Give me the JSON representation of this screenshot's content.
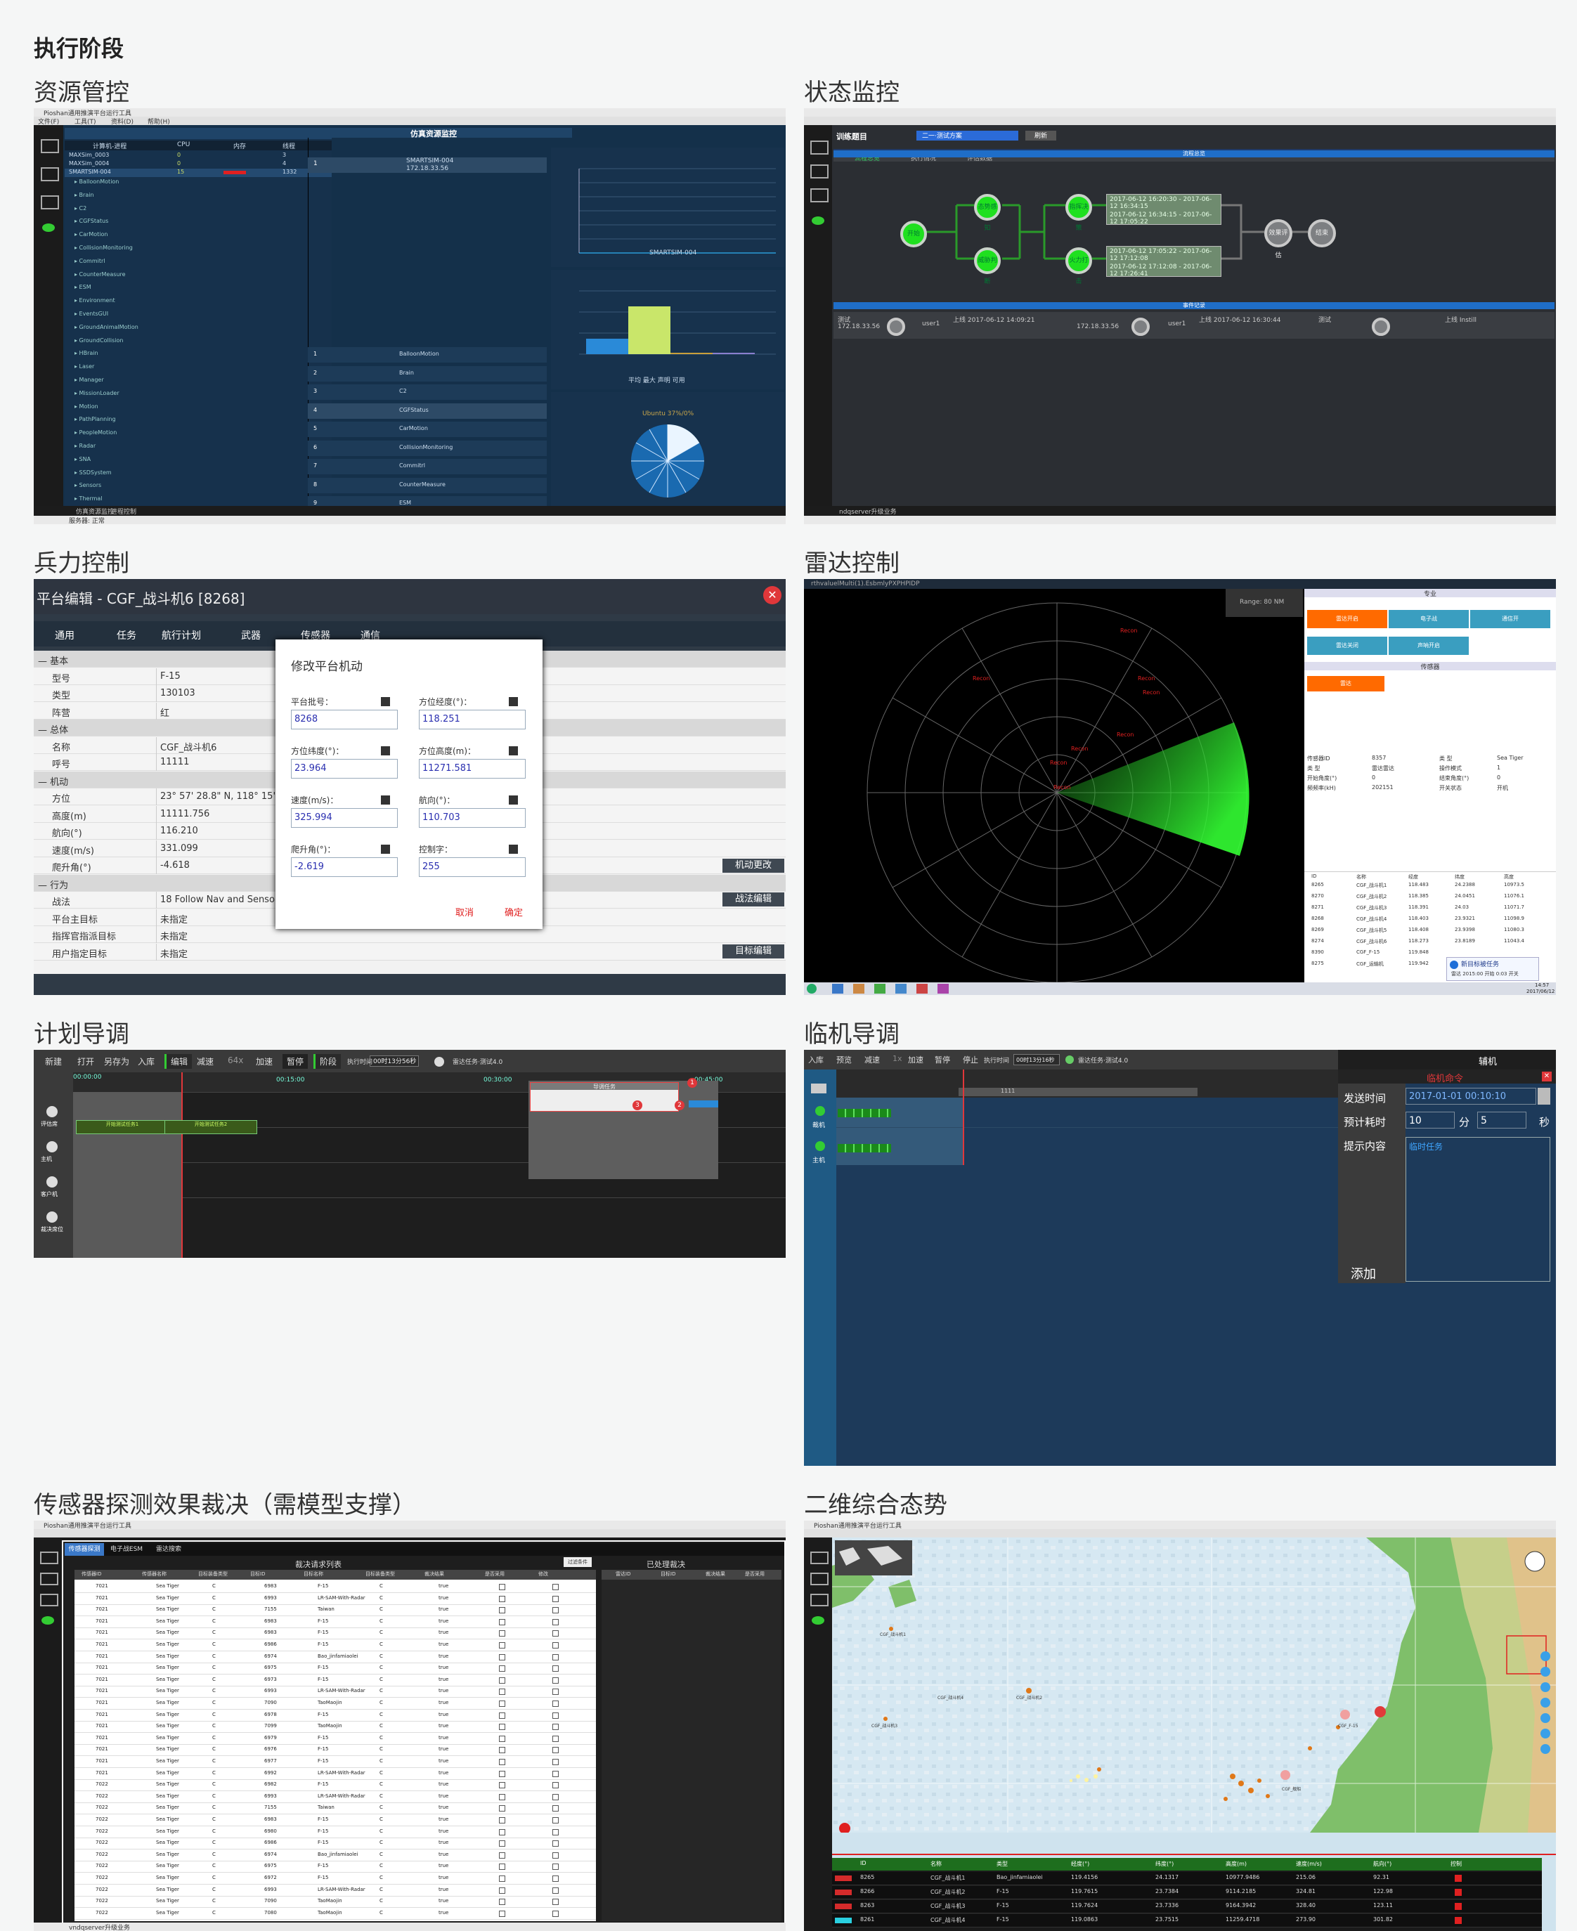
{
  "page": {
    "title": "执行阶段"
  },
  "sections": [
    {
      "label": "资源管控"
    },
    {
      "label": "状态监控"
    },
    {
      "label": "兵力控制"
    },
    {
      "label": "雷达控制"
    },
    {
      "label": "计划导调"
    },
    {
      "label": "临机导调"
    },
    {
      "label": "传感器探测效果裁决（需模型支撑）"
    },
    {
      "label": "二维综合态势"
    }
  ],
  "resource": {
    "window_title": "Pioshan通用推演平台运行工具",
    "menu": [
      "文件(F)",
      "工具(T)",
      "资料(D)",
      "帮助(H)"
    ],
    "panel_title": "仿真资源监控",
    "headers": [
      "计算机-进程",
      "CPU",
      "内存",
      "线程"
    ],
    "machines": [
      {
        "name": "MAXSim_0003",
        "cpu": "0",
        "mem": "0",
        "thr": "3"
      },
      {
        "name": "MAXSim_0004",
        "cpu": "0",
        "mem": "0",
        "thr": "4"
      },
      {
        "name": "SMARTSIM-004",
        "cpu": "15",
        "mem": "",
        "thr": "1332"
      }
    ],
    "modules": [
      "BalloonMotion",
      "Brain",
      "C2",
      "CGFStatus",
      "CarMotion",
      "CollisionMonitoring",
      "Commitrl",
      "CounterMeasure",
      "ESM",
      "Environment",
      "EventsGUI",
      "GroundAnimalMotion",
      "GroundCollision",
      "HBrain",
      "Laser",
      "Manager",
      "MissionLoader",
      "Motion",
      "PathPlanning",
      "PeopleMotion",
      "Radar",
      "SNA",
      "SSDSystem",
      "Sensors",
      "Thermal"
    ],
    "list_nodes": [
      "BalloonMotion",
      "Brain",
      "C2",
      "CGFStatus",
      "CarMotion",
      "CollisionMonitoring",
      "Commitrl",
      "CounterMeasure",
      "ESM"
    ],
    "host_name": "SMARTSIM-004",
    "host_ip": "172.18.33.56",
    "line_legend": "SMARTSIM-004",
    "bar_legend": [
      "平均",
      "最大",
      "声明",
      "可用"
    ],
    "pie_label": "Ubuntu 37%/0%",
    "bottom_tabs": [
      "仿真资源监控",
      "进程控制"
    ],
    "status": "服务器: 正常"
  },
  "status_monitor": {
    "label_training": "训练题目",
    "select_value": "二一·测试方案",
    "button": "刷新",
    "tabs": [
      "流程总览",
      "执行情况",
      "评估数据"
    ],
    "section1": "流程总览",
    "section2": "事件记录",
    "nodes": {
      "start": "开始",
      "a1": "态势感知",
      "a2": "威胁判断",
      "b1": "指挥决策",
      "b2": "火力打击",
      "eval": "效果评估",
      "end": "结束"
    },
    "log_lines": [
      "2017-06-12 16:20:30 - 2017-06-12 16:34:15",
      "2017-06-12 16:34:15 - 2017-06-12 17:05:22",
      "2017-06-12 17:05:22 - 2017-06-12 17:12:08",
      "2017-06-12 17:12:08 - 2017-06-12 17:26:41"
    ],
    "events": [
      {
        "id": "测试",
        "ip": "172.18.33.56",
        "user": "user1",
        "info": "上线 2017-06-12 14:09:21"
      },
      {
        "id": "",
        "ip": "172.18.33.56",
        "user": "user1",
        "info": "上线 2017-06-12 16:30:44"
      },
      {
        "id": "测试",
        "ip": "",
        "user": "",
        "info": "上线 Instill"
      }
    ],
    "status": "ndqserver升级业务"
  },
  "force": {
    "title": "平台编辑 - CGF_战斗机6 [8268]",
    "tabs": [
      "通用",
      "任务",
      "航行计划",
      "武器",
      "传感器",
      "通信"
    ],
    "rows": [
      {
        "k": "基本",
        "v": "",
        "group": true
      },
      {
        "k": "型号",
        "v": "F-15"
      },
      {
        "k": "类型",
        "v": "130103"
      },
      {
        "k": "阵营",
        "v": "红"
      },
      {
        "k": "总体",
        "v": "",
        "group": true
      },
      {
        "k": "名称",
        "v": "CGF_战斗机6"
      },
      {
        "k": "呼号",
        "v": "11111"
      },
      {
        "k": "机动",
        "v": "",
        "group": true
      },
      {
        "k": "方位",
        "v": "23° 57' 28.8\" N, 118° 15' 55.2"
      },
      {
        "k": "高度(m)",
        "v": "11111.756"
      },
      {
        "k": "航向(°)",
        "v": "116.210"
      },
      {
        "k": "速度(m/s)",
        "v": "331.099"
      },
      {
        "k": "爬升角(°)",
        "v": "-4.618"
      },
      {
        "k": "行为",
        "v": "",
        "group": true
      },
      {
        "k": "战法",
        "v": "18  Follow Nav and Sensor P"
      },
      {
        "k": "平台主目标",
        "v": "未指定"
      },
      {
        "k": "指挥官指派目标",
        "v": "未指定"
      },
      {
        "k": "用户指定目标",
        "v": "未指定"
      }
    ],
    "side_buttons": [
      "机动更改",
      "战法编辑",
      "目标编辑"
    ],
    "dialog": {
      "title": "修改平台机动",
      "fields": [
        {
          "label": "平台批号：",
          "value": "8268"
        },
        {
          "label": "方位经度(°)：",
          "value": "118.251"
        },
        {
          "label": "方位纬度(°)：",
          "value": "23.964"
        },
        {
          "label": "方位高度(m)：",
          "value": "11271.581"
        },
        {
          "label": "速度(m/s)：",
          "value": "325.994"
        },
        {
          "label": "航向(°)：",
          "value": "110.703"
        },
        {
          "label": "爬升角(°)：",
          "value": "-2.619"
        },
        {
          "label": "控制字：",
          "value": "255"
        }
      ],
      "cancel": "取消",
      "ok": "确定"
    }
  },
  "radar": {
    "window_title": "rthvaluelMulti(1).EsbmlyPXPHPIDP",
    "range_label": "Range: 80 NM",
    "panel_title": "专业",
    "modes": [
      "雷达开启",
      "电子战",
      "通信开",
      "雷达关闭",
      "声呐开启"
    ],
    "sensor_title": "传感器",
    "sensor_active": "雷达",
    "props": [
      {
        "k": "传感器ID",
        "v": "8357",
        "k2": "类 型",
        "v2": "Sea Tiger"
      },
      {
        "k": "类 型",
        "v": "雷达雷达",
        "k2": "操作模式",
        "v2": "1"
      },
      {
        "k": "开始角度(°)",
        "v": "0",
        "k2": "结束角度(°)",
        "v2": "0"
      },
      {
        "k": "频频率(kH)",
        "v": "202151",
        "k2": "开关状态",
        "v2": "开机"
      }
    ],
    "table_headers": [
      "ID",
      "名称",
      "经度",
      "纬度",
      "高度"
    ],
    "table_rows": [
      [
        "8265",
        "CGF_战斗机1",
        "118.483",
        "24.2388",
        "10973.5"
      ],
      [
        "8270",
        "CGF_战斗机2",
        "118.385",
        "24.0451",
        "11076.1"
      ],
      [
        "8271",
        "CGF_战斗机3",
        "118.391",
        "24.03",
        "11071.7"
      ],
      [
        "8268",
        "CGF_战斗机4",
        "118.403",
        "23.9321",
        "11098.9"
      ],
      [
        "8269",
        "CGF_战斗机5",
        "118.408",
        "23.9398",
        "11080.3"
      ],
      [
        "8274",
        "CGF_战斗机6",
        "118.273",
        "23.8189",
        "11043.4"
      ],
      [
        "8390",
        "CGF_F-15",
        "119.848",
        "",
        ""
      ],
      [
        "8275",
        "CGF_运输机",
        "119.942",
        "",
        ""
      ]
    ],
    "notify_title": "新目标被任务",
    "notify_text": "雷达 2015:00 开始 0:03 开关",
    "time": "14:57",
    "date": "2017/06/12"
  },
  "plan": {
    "toolbar": [
      "新建",
      "打开",
      "另存为",
      "入库",
      "编辑",
      "减速",
      "64x",
      "加速",
      "暂停",
      "阶段"
    ],
    "exec_label": "执行时间",
    "exec_time": "00时13分56秒",
    "progress_label": "雷达任务·测试4.0",
    "time_ticks": [
      "00:00:00",
      "00:15:00",
      "00:30:00",
      "00:45:00"
    ],
    "roles": [
      "评估席",
      "主机",
      "客户机",
      "裁决席位"
    ],
    "task_popup": "导调任务",
    "task_boxes": [
      "开始测试任务1",
      "开始测试任务2"
    ],
    "markers": [
      "1",
      "2",
      "3"
    ]
  },
  "adhoc": {
    "toolbar": [
      "入库",
      "预览",
      "减速",
      "1x",
      "加速",
      "暂停",
      "停止"
    ],
    "exec_label": "执行时间",
    "exec_time": "00时13分16秒",
    "progress_label": "雷达任务·测试4.0",
    "side_title": "辅机",
    "panel_title": "临机命令",
    "send_time_label": "发送时间",
    "send_time": "2017-01-01  00:10:10",
    "duration_label": "预计耗时",
    "duration_min": "10",
    "min_unit": "分",
    "duration_sec": "5",
    "sec_unit": "秒",
    "content_label": "提示内容",
    "content_value": "临时任务",
    "add_button": "添加",
    "roles": [
      "裁机",
      "主机"
    ],
    "track_value": "1111"
  },
  "sensor": {
    "window_title": "Pioshan通用推演平台运行工具",
    "tabs": [
      "传感器探测",
      "电子战ESM",
      "雷达搜索"
    ],
    "list_title": "裁决请求列表",
    "done_title": "已处理裁决",
    "filter_button": "过滤条件",
    "headers": [
      "传感器ID",
      "传感器名称",
      "目标装备类型",
      "目标ID",
      "目标名称",
      "目标装备类型",
      "裁决结果",
      "是否采用",
      "修改"
    ],
    "done_headers": [
      "雷达ID",
      "目标ID",
      "裁决结果",
      "是否采用"
    ],
    "rows": [
      [
        "7021",
        "Sea Tiger",
        "C",
        "6983",
        "F-15",
        "C",
        "true"
      ],
      [
        "7021",
        "Sea Tiger",
        "C",
        "6993",
        "LR-SAM-With-Radar",
        "C",
        "true"
      ],
      [
        "7021",
        "Sea Tiger",
        "C",
        "7155",
        "Taiwan",
        "C",
        "true"
      ],
      [
        "7021",
        "Sea Tiger",
        "C",
        "6983",
        "F-15",
        "C",
        "true"
      ],
      [
        "7021",
        "Sea Tiger",
        "C",
        "6983",
        "F-15",
        "C",
        "true"
      ],
      [
        "7021",
        "Sea Tiger",
        "C",
        "6986",
        "F-15",
        "C",
        "true"
      ],
      [
        "7021",
        "Sea Tiger",
        "C",
        "6974",
        "Bao_jinfamiaolei",
        "C",
        "true"
      ],
      [
        "7021",
        "Sea Tiger",
        "C",
        "6975",
        "F-15",
        "C",
        "true"
      ],
      [
        "7021",
        "Sea Tiger",
        "C",
        "6973",
        "F-15",
        "C",
        "true"
      ],
      [
        "7021",
        "Sea Tiger",
        "C",
        "6993",
        "LR-SAM-With-Radar",
        "C",
        "true"
      ],
      [
        "7021",
        "Sea Tiger",
        "C",
        "7090",
        "TaoMaojin",
        "C",
        "true"
      ],
      [
        "7021",
        "Sea Tiger",
        "C",
        "6978",
        "F-15",
        "C",
        "true"
      ],
      [
        "7021",
        "Sea Tiger",
        "C",
        "7099",
        "TaoMaojin",
        "C",
        "true"
      ],
      [
        "7021",
        "Sea Tiger",
        "C",
        "6979",
        "F-15",
        "C",
        "true"
      ],
      [
        "7021",
        "Sea Tiger",
        "C",
        "6976",
        "F-15",
        "C",
        "true"
      ],
      [
        "7021",
        "Sea Tiger",
        "C",
        "6977",
        "F-15",
        "C",
        "true"
      ],
      [
        "7021",
        "Sea Tiger",
        "C",
        "6992",
        "LR-SAM-With-Radar",
        "C",
        "true"
      ],
      [
        "7022",
        "Sea Tiger",
        "C",
        "6982",
        "F-15",
        "C",
        "true"
      ],
      [
        "7022",
        "Sea Tiger",
        "C",
        "6993",
        "LR-SAM-With-Radar",
        "C",
        "true"
      ],
      [
        "7022",
        "Sea Tiger",
        "C",
        "7155",
        "Taiwan",
        "C",
        "true"
      ],
      [
        "7022",
        "Sea Tiger",
        "C",
        "6983",
        "F-15",
        "C",
        "true"
      ],
      [
        "7022",
        "Sea Tiger",
        "C",
        "6980",
        "F-15",
        "C",
        "true"
      ],
      [
        "7022",
        "Sea Tiger",
        "C",
        "6986",
        "F-15",
        "C",
        "true"
      ],
      [
        "7022",
        "Sea Tiger",
        "C",
        "6974",
        "Bao_jinfamiaolei",
        "C",
        "true"
      ],
      [
        "7022",
        "Sea Tiger",
        "C",
        "6975",
        "F-15",
        "C",
        "true"
      ],
      [
        "7022",
        "Sea Tiger",
        "C",
        "6972",
        "F-15",
        "C",
        "true"
      ],
      [
        "7022",
        "Sea Tiger",
        "C",
        "6993",
        "LR-SAM-With-Radar",
        "C",
        "true"
      ],
      [
        "7022",
        "Sea Tiger",
        "C",
        "7090",
        "TaoMaojin",
        "C",
        "true"
      ],
      [
        "7022",
        "Sea Tiger",
        "C",
        "7080",
        "TaoMaojin",
        "C",
        "true"
      ]
    ],
    "status": "vndqserver升级业务"
  },
  "situation": {
    "window_title": "Pioshan通用推演平台运行工具",
    "units": [
      "CGF_战斗机1",
      "CGF_战斗机2",
      "CGF_战斗机3",
      "CGF_战斗机4",
      "CGF_F-15",
      "CGF_舰船"
    ],
    "table_headers": [
      "ID",
      "名称",
      "类型",
      "经度(°)",
      "纬度(°)",
      "高度(m)",
      "速度(m/s)",
      "航向(°)",
      "控制"
    ],
    "table_rows": [
      [
        "8265",
        "CGF_战斗机1",
        "Bao_jinfamiaolei",
        "119.4156",
        "24.1317",
        "10977.9486",
        "215.06",
        "92.31"
      ],
      [
        "8266",
        "CGF_战斗机2",
        "F-15",
        "119.7615",
        "23.7384",
        "9114.2185",
        "324.81",
        "122.98"
      ],
      [
        "8263",
        "CGF_战斗机3",
        "F-15",
        "119.7624",
        "23.7336",
        "9164.3942",
        "328.40",
        "123.11"
      ],
      [
        "8261",
        "CGF_战斗机4",
        "F-15",
        "119.0863",
        "23.7515",
        "11259.4718",
        "273.90",
        "301.82"
      ]
    ],
    "colors": {
      "red": "#d42b2b",
      "cyan": "#2ad0e0"
    }
  }
}
